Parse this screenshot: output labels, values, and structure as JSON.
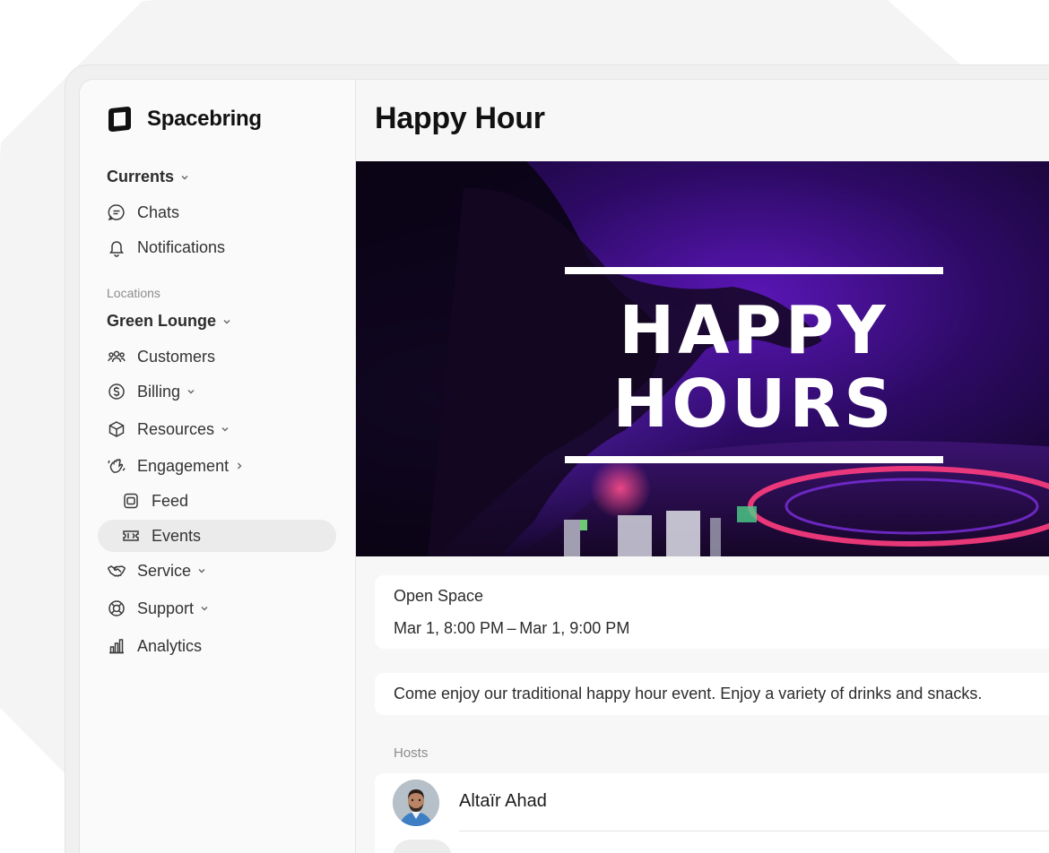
{
  "brand": {
    "name": "Spacebring",
    "logo_icon": "spacebring-logo-icon"
  },
  "sidebar": {
    "currents": {
      "label": "Currents"
    },
    "top_items": [
      {
        "label": "Chats",
        "icon": "chat-bubble-icon"
      },
      {
        "label": "Notifications",
        "icon": "bell-icon"
      }
    ],
    "locations_label": "Locations",
    "location": {
      "label": "Green Lounge"
    },
    "items": [
      {
        "label": "Customers",
        "icon": "users-icon"
      },
      {
        "label": "Billing",
        "icon": "dollar-circle-icon"
      },
      {
        "label": "Resources",
        "icon": "cube-icon"
      },
      {
        "label": "Engagement",
        "icon": "waving-hand-icon"
      },
      {
        "label": "Feed",
        "icon": "feed-icon"
      },
      {
        "label": "Events",
        "icon": "ticket-icon",
        "active": true
      },
      {
        "label": "Service",
        "icon": "handshake-icon"
      },
      {
        "label": "Support",
        "icon": "lifebuoy-icon"
      },
      {
        "label": "Analytics",
        "icon": "bar-chart-icon"
      }
    ]
  },
  "main": {
    "title": "Happy Hour",
    "hero": {
      "line1": "HAPPY",
      "line2": "HOURS"
    },
    "details": {
      "location": "Open Space",
      "time": "Mar 1, 8:00 PM – Mar 1, 9:00 PM"
    },
    "description": "Come enjoy our traditional happy hour event. Enjoy a variety of drinks and snacks.",
    "hosts_label": "Hosts",
    "hosts": [
      {
        "name": "Altaïr Ahad"
      }
    ]
  },
  "colors": {
    "accent_purple": "#6a1fd1",
    "active_bg": "#ebebeb",
    "text": "#1c1c1c",
    "muted": "#8c8c8c"
  }
}
